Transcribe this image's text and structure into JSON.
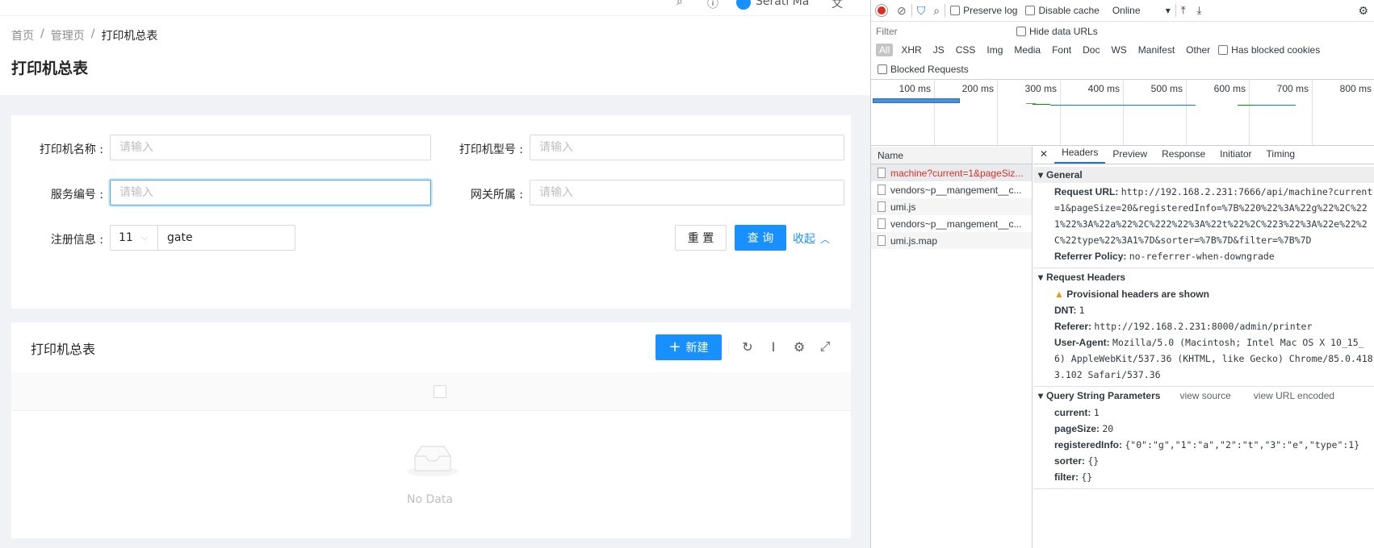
{
  "app": {
    "topbar": {
      "user": "Serati Ma"
    },
    "breadcrumb": [
      "首页",
      "管理页",
      "打印机总表"
    ],
    "page_title": "打印机总表",
    "search": {
      "printer_name_label": "打印机名称 :",
      "printer_model_label": "打印机型号 :",
      "service_no_label": "服务编号 :",
      "gateway_label": "网关所属 :",
      "reg_info_label": "注册信息 :",
      "placeholder": "请输入",
      "reg_select_value": "11",
      "reg_text_value": "gate",
      "reset_label": "重 置",
      "query_label": "查 询",
      "collapse_label": "收起"
    },
    "table": {
      "title": "打印机总表",
      "new_label": "新建",
      "no_data": "No Data"
    },
    "colors": {
      "primary": "#1890ff"
    }
  },
  "devtools": {
    "throttle": "Online",
    "preserve_log": "Preserve log",
    "disable_cache": "Disable cache",
    "filter_placeholder": "Filter",
    "hide_data_urls": "Hide data URLs",
    "type_filters": [
      "All",
      "XHR",
      "JS",
      "CSS",
      "Img",
      "Media",
      "Font",
      "Doc",
      "WS",
      "Manifest",
      "Other"
    ],
    "has_blocked_cookies": "Has blocked cookies",
    "blocked_requests": "Blocked Requests",
    "timeline_labels": [
      "100 ms",
      "200 ms",
      "300 ms",
      "400 ms",
      "500 ms",
      "600 ms",
      "700 ms",
      "800 ms"
    ],
    "name_header": "Name",
    "requests": [
      {
        "name": "machine?current=1&pageSiz...",
        "error": true
      },
      {
        "name": "vendors~p__mangement__c...",
        "error": false
      },
      {
        "name": "umi.js",
        "error": false
      },
      {
        "name": "vendors~p__mangement__c...",
        "error": false
      },
      {
        "name": "umi.js.map",
        "error": false
      }
    ],
    "tabs": [
      "Headers",
      "Preview",
      "Response",
      "Initiator",
      "Timing"
    ],
    "general": {
      "title": "General",
      "request_url_label": "Request URL:",
      "request_url": "http://192.168.2.231:7666/api/machine?current=1&pageSize=20&registeredInfo=%7B%220%22%3A%22g%22%2C%221%22%3A%22a%22%2C%222%22%3A%22t%22%2C%223%22%3A%22e%22%2C%22type%22%3A1%7D&sorter=%7B%7D&filter=%7B%7D",
      "referrer_policy_label": "Referrer Policy:",
      "referrer_policy": "no-referrer-when-downgrade"
    },
    "request_headers": {
      "title": "Request Headers",
      "warning": "Provisional headers are shown",
      "dnt_label": "DNT:",
      "dnt": "1",
      "referer_label": "Referer:",
      "referer": "http://192.168.2.231:8000/admin/printer",
      "ua_label": "User-Agent:",
      "ua": "Mozilla/5.0 (Macintosh; Intel Mac OS X 10_15_6) AppleWebKit/537.36 (KHTML, like Gecko) Chrome/85.0.4183.102 Safari/537.36"
    },
    "query": {
      "title": "Query String Parameters",
      "view_source": "view source",
      "view_url_encoded": "view URL encoded",
      "params": [
        {
          "k": "current:",
          "v": "1"
        },
        {
          "k": "pageSize:",
          "v": "20"
        },
        {
          "k": "registeredInfo:",
          "v": "{\"0\":\"g\",\"1\":\"a\",\"2\":\"t\",\"3\":\"e\",\"type\":1}"
        },
        {
          "k": "sorter:",
          "v": "{}"
        },
        {
          "k": "filter:",
          "v": "{}"
        }
      ]
    }
  }
}
